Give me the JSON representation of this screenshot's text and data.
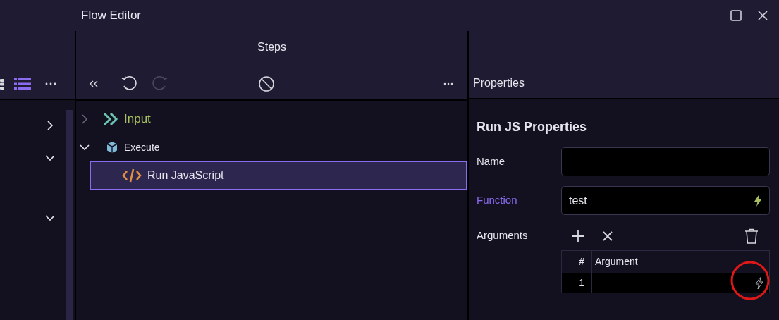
{
  "window": {
    "title": "Flow Editor"
  },
  "sidebar": {
    "items": [
      {
        "expanded": false
      },
      {
        "expanded": true
      },
      {
        "expanded": true
      }
    ]
  },
  "steps": {
    "title": "Steps",
    "tree": [
      {
        "label": "Input",
        "kind": "input",
        "expanded": false,
        "selected": false
      },
      {
        "label": "Execute",
        "kind": "group",
        "expanded": true,
        "selected": false,
        "children": [
          {
            "label": "Run JavaScript",
            "kind": "script",
            "selected": true
          }
        ]
      }
    ]
  },
  "properties": {
    "title": "Properties",
    "heading": "Run JS Properties",
    "fields": [
      {
        "label": "Name",
        "bound": false
      },
      {
        "label": "Function",
        "value": "test",
        "bound": true
      }
    ],
    "arguments": {
      "label": "Arguments",
      "columns": [
        "#",
        "Argument"
      ],
      "rows": [
        {
          "index": "1"
        }
      ]
    }
  }
}
